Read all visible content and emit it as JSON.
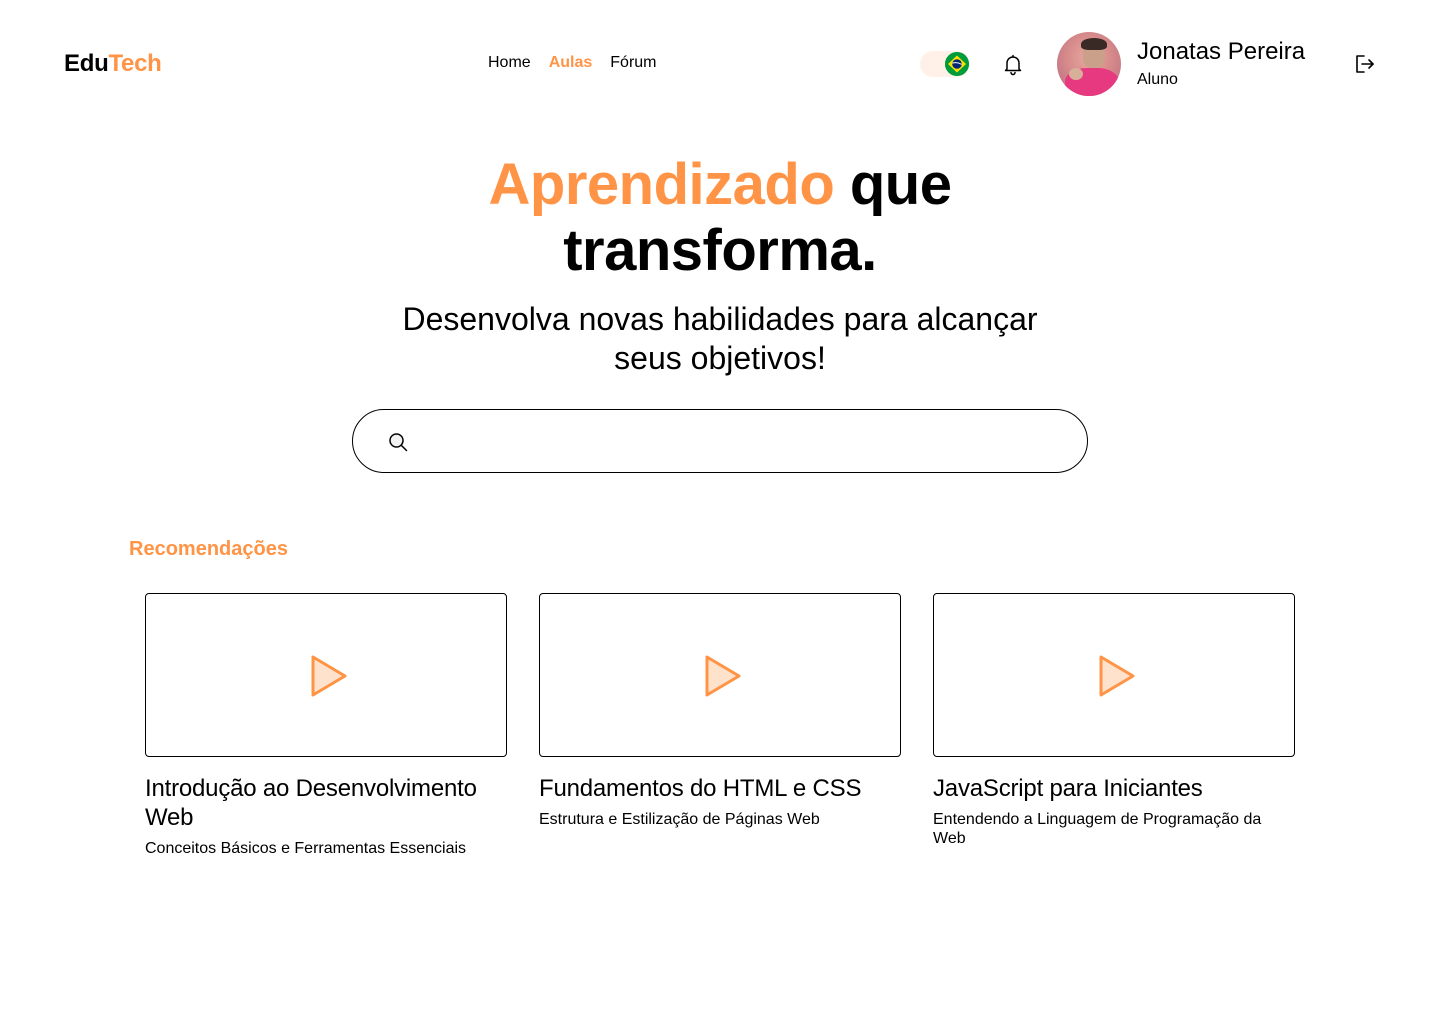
{
  "header": {
    "logo_part1": "Edu",
    "logo_part2": "Tech",
    "nav": [
      {
        "label": "Home",
        "active": false
      },
      {
        "label": "Aulas",
        "active": true
      },
      {
        "label": "Fórum",
        "active": false
      }
    ],
    "language_flag": "brazil-flag-icon",
    "user": {
      "name": "Jonatas Pereira",
      "role": "Aluno"
    }
  },
  "hero": {
    "title_accent": "Aprendizado",
    "title_rest_line1": " que",
    "title_line2": "transforma.",
    "subtitle": "Desenvolva novas habilidades para alcançar seus objetivos!"
  },
  "search": {
    "placeholder": ""
  },
  "recommendations": {
    "title": "Recomendações",
    "items": [
      {
        "title": "Introdução ao Desenvolvimento Web",
        "subtitle": "Conceitos Básicos e Ferramentas Essenciais"
      },
      {
        "title": "Fundamentos do HTML e CSS",
        "subtitle": "Estrutura e Estilização de Páginas Web"
      },
      {
        "title": "JavaScript para Iniciantes",
        "subtitle": "Entendendo a Linguagem de Programação da Web"
      }
    ]
  },
  "colors": {
    "accent": "#ff9447",
    "play_fill": "#ffe2cc"
  }
}
